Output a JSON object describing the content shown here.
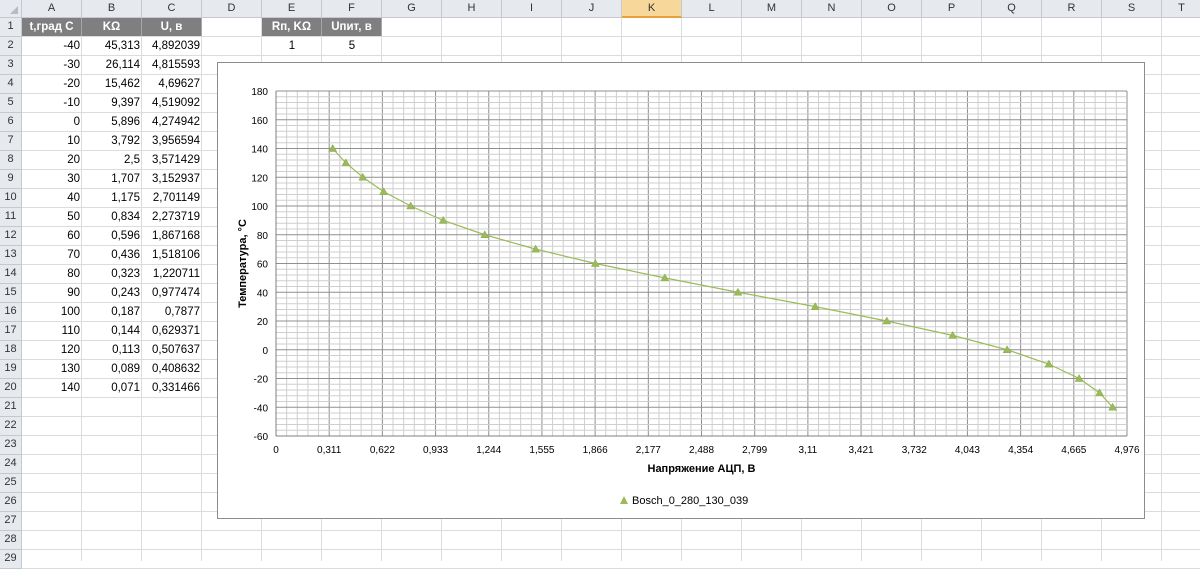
{
  "columns": [
    "A",
    "B",
    "C",
    "D",
    "E",
    "F",
    "G",
    "H",
    "I",
    "J",
    "K",
    "L",
    "M",
    "N",
    "O",
    "P",
    "Q",
    "R",
    "S",
    "T"
  ],
  "selected_column": "K",
  "rows": [
    "1",
    "2",
    "3",
    "4",
    "5",
    "6",
    "7",
    "8",
    "9",
    "10",
    "11",
    "12",
    "13",
    "14",
    "15",
    "16",
    "17",
    "18",
    "19",
    "20",
    "21",
    "22",
    "23",
    "24",
    "25",
    "26",
    "27",
    "28",
    "29"
  ],
  "table": {
    "headers": [
      "t,град С",
      "KΩ",
      "U, в"
    ],
    "rows": [
      [
        "-40",
        "45,313",
        "4,892039"
      ],
      [
        "-30",
        "26,114",
        "4,815593"
      ],
      [
        "-20",
        "15,462",
        "4,69627"
      ],
      [
        "-10",
        "9,397",
        "4,519092"
      ],
      [
        "0",
        "5,896",
        "4,274942"
      ],
      [
        "10",
        "3,792",
        "3,956594"
      ],
      [
        "20",
        "2,5",
        "3,571429"
      ],
      [
        "30",
        "1,707",
        "3,152937"
      ],
      [
        "40",
        "1,175",
        "2,701149"
      ],
      [
        "50",
        "0,834",
        "2,273719"
      ],
      [
        "60",
        "0,596",
        "1,867168"
      ],
      [
        "70",
        "0,436",
        "1,518106"
      ],
      [
        "80",
        "0,323",
        "1,220711"
      ],
      [
        "90",
        "0,243",
        "0,977474"
      ],
      [
        "100",
        "0,187",
        "0,7877"
      ],
      [
        "110",
        "0,144",
        "0,629371"
      ],
      [
        "120",
        "0,113",
        "0,507637"
      ],
      [
        "130",
        "0,089",
        "0,408632"
      ],
      [
        "140",
        "0,071",
        "0,331466"
      ]
    ]
  },
  "params": {
    "headers": [
      "Rп, KΩ",
      "Uпит, в"
    ],
    "values": [
      "1",
      "5"
    ]
  },
  "chart_data": {
    "type": "scatter",
    "title": "",
    "xlabel": "Напряжение АЦП, В",
    "ylabel": "Температура, °С",
    "xlim": [
      0,
      4.976
    ],
    "ylim": [
      -60,
      180
    ],
    "x_ticks": [
      "0",
      "0,311",
      "0,622",
      "0,933",
      "1,244",
      "1,555",
      "1,866",
      "2,177",
      "2,488",
      "2,799",
      "3,11",
      "3,421",
      "3,732",
      "4,043",
      "4,354",
      "4,665",
      "4,976"
    ],
    "y_ticks": [
      "-60",
      "-40",
      "-20",
      "0",
      "20",
      "40",
      "60",
      "80",
      "100",
      "120",
      "140",
      "160",
      "180"
    ],
    "grid": true,
    "legend_position": "bottom",
    "marker": "triangle",
    "color": "#9bbb59",
    "series": [
      {
        "name": "Bosch_0_280_130_039",
        "x": [
          4.892039,
          4.815593,
          4.69627,
          4.519092,
          4.274942,
          3.956594,
          3.571429,
          3.152937,
          2.701149,
          2.273719,
          1.867168,
          1.518106,
          1.220711,
          0.977474,
          0.7877,
          0.629371,
          0.507637,
          0.408632,
          0.331466
        ],
        "y": [
          -40,
          -30,
          -20,
          -10,
          0,
          10,
          20,
          30,
          40,
          50,
          60,
          70,
          80,
          90,
          100,
          110,
          120,
          130,
          140
        ]
      }
    ]
  }
}
